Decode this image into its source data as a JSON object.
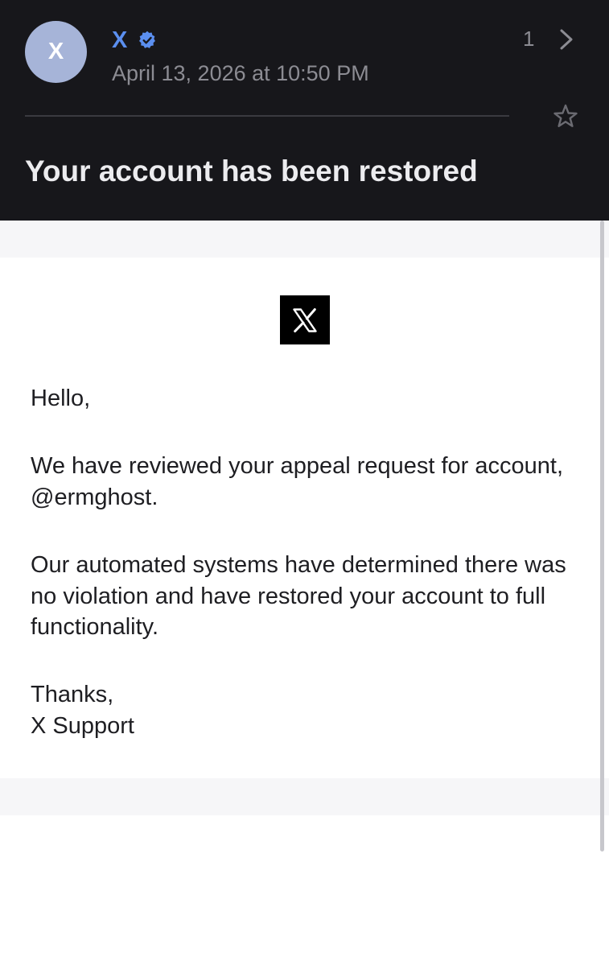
{
  "header": {
    "avatar_letter": "X",
    "sender_name": "X",
    "timestamp": "April 13, 2026 at 10:50 PM",
    "message_count": "1",
    "subject": "Your account has been restored"
  },
  "email": {
    "greeting": "Hello,",
    "paragraph_1": "We have reviewed your appeal request for account, @ermghost.",
    "paragraph_2": "Our automated systems have determined there was no violation and have restored your account to full functionality.",
    "signoff": "Thanks,",
    "signature": "X Support"
  },
  "icons": [
    "verified-badge-icon",
    "chevron-right-icon",
    "star-icon",
    "x-logo-icon"
  ],
  "colors": {
    "header_background": "#17171b",
    "sender_accent": "#5b8ff0",
    "avatar_background": "#a6b4d8"
  }
}
